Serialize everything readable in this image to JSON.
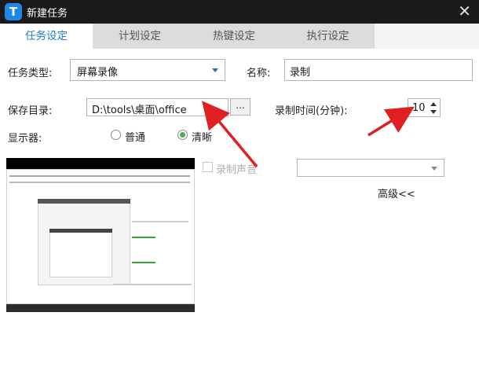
{
  "window": {
    "title": "新建任务",
    "close": "✕",
    "icon_letter": "T"
  },
  "tabs": [
    {
      "label": "任务设定",
      "active": true
    },
    {
      "label": "计划设定",
      "active": false
    },
    {
      "label": "热键设定",
      "active": false
    },
    {
      "label": "执行设定",
      "active": false
    }
  ],
  "form": {
    "task_type_label": "任务类型:",
    "task_type_value": "屏幕录像",
    "name_label": "名称:",
    "name_value": "录制",
    "save_dir_label": "保存目录:",
    "save_dir_value": "D:\\tools\\桌面\\office",
    "browse_label": "...",
    "record_time_label": "录制时间(分钟):",
    "record_time_value": "10",
    "display_label": "显示器:",
    "display_options": [
      {
        "label": "普通",
        "checked": false
      },
      {
        "label": "清晰",
        "checked": true
      }
    ],
    "record_sound_label": "录制声音",
    "advanced_label": "高级<<"
  },
  "colors": {
    "titlebar": "#1a1a1a",
    "active_tab_text": "#1e7fd0",
    "annotation_arrow": "#e02020"
  },
  "icons": [
    "app-logo-icon",
    "close-icon",
    "dropdown-caret-icon",
    "spin-up-icon",
    "spin-down-icon"
  ]
}
